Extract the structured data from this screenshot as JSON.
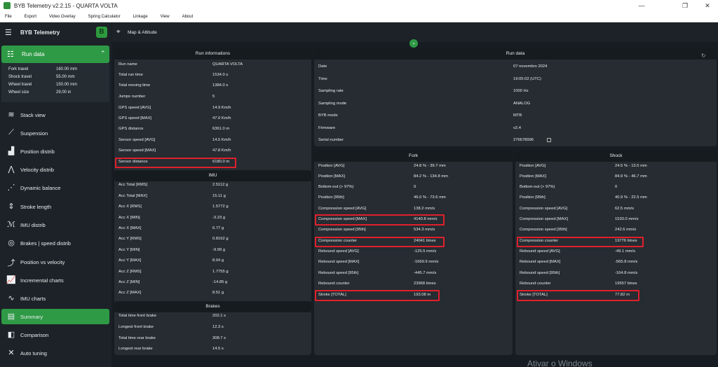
{
  "window": {
    "title": "BYB Telemetry v2.2.15 - QUARTA VOLTA"
  },
  "menu": [
    "File",
    "Export",
    "Video Overlay",
    "Spring Calculator",
    "Linkage",
    "View",
    "About"
  ],
  "sidebar": {
    "app_title": "BYB Telemetry",
    "run_data_label": "Run data",
    "run_summary": [
      {
        "k": "Fork travel",
        "v": "160.00 mm"
      },
      {
        "k": "Shock travel",
        "v": "55.00 mm"
      },
      {
        "k": "Wheel travel",
        "v": "150.00 mm"
      },
      {
        "k": "Wheel size",
        "v": "29.00 in"
      }
    ],
    "items": [
      {
        "label": "Stack view",
        "icon": "layers-icon",
        "glyph": "≋"
      },
      {
        "label": "Suspension",
        "icon": "suspension-icon",
        "glyph": "⟋"
      },
      {
        "label": "Position distrib",
        "icon": "bar-chart-icon",
        "glyph": "▟"
      },
      {
        "label": "Velocity distrib",
        "icon": "bell-curve-icon",
        "glyph": "⋀"
      },
      {
        "label": "Dynamic balance",
        "icon": "scatter-icon",
        "glyph": "⋰"
      },
      {
        "label": "Stroke length",
        "icon": "stroke-icon",
        "glyph": "⇕"
      },
      {
        "label": "IMU distrib",
        "icon": "imu-icon",
        "glyph": "ℳ"
      },
      {
        "label": "Brakes | speed distrib",
        "icon": "brake-disc-icon",
        "glyph": "◎"
      },
      {
        "label": "Position vs velocity",
        "icon": "scatter-trend-icon",
        "glyph": "⤴"
      },
      {
        "label": "Incremental charts",
        "icon": "line-chart-icon",
        "glyph": "📈"
      },
      {
        "label": "IMU charts",
        "icon": "imu-chart-icon",
        "glyph": "∿"
      },
      {
        "label": "Summary",
        "icon": "summary-icon",
        "glyph": "▤"
      },
      {
        "label": "Comparison",
        "icon": "comparison-icon",
        "glyph": "◧"
      },
      {
        "label": "Auto tuning",
        "icon": "tools-icon",
        "glyph": "✕"
      }
    ]
  },
  "topbar": {
    "label": "Map & Altitude"
  },
  "run_info": {
    "title": "Run informations",
    "rows": [
      {
        "k": "Run name",
        "v": "QUARTA VOLTA"
      },
      {
        "k": "Total run time",
        "v": "1534.0 s"
      },
      {
        "k": "Total moving time",
        "v": "1384.0 s"
      },
      {
        "k": "Jumps number",
        "v": "5"
      },
      {
        "k": "GPS speed [AVG]",
        "v": "14.9 Km/h"
      },
      {
        "k": "GPS speed [MAX]",
        "v": "47.0 Km/h"
      },
      {
        "k": "GPS distance",
        "v": "6361.0 m"
      },
      {
        "k": "Sensor speed [AVG]",
        "v": "14.5 Km/h"
      },
      {
        "k": "Sensor speed [MAX]",
        "v": "47.8 Km/h"
      },
      {
        "k": "Sensor distance",
        "v": "6180.0 m"
      }
    ],
    "imu_title": "IMU",
    "imu_rows": [
      {
        "k": "Acc Total [RMS]",
        "v": "2.5112 g"
      },
      {
        "k": "Acc Total [MAX]",
        "v": "15.11 g"
      },
      {
        "k": "Acc X [RMS]",
        "v": "1.5772 g"
      },
      {
        "k": "Acc X [MIN]",
        "v": "-3.23 g"
      },
      {
        "k": "Acc X [MAX]",
        "v": "6.77 g"
      },
      {
        "k": "Acc Y [RMS]",
        "v": "0.8162 g"
      },
      {
        "k": "Acc Y [MIN]",
        "v": "-9.99 g"
      },
      {
        "k": "Acc Y [MAX]",
        "v": "8.04 g"
      },
      {
        "k": "Acc Z [RMS]",
        "v": "1.7755 g"
      },
      {
        "k": "Acc Z [MIN]",
        "v": "-14.85 g"
      },
      {
        "k": "Acc Z [MAX]",
        "v": "8.51 g"
      }
    ],
    "brakes_title": "Brakes",
    "brakes_rows": [
      {
        "k": "Total time front brake",
        "v": "202.1 s"
      },
      {
        "k": "Longest front brake",
        "v": "12.3 s"
      },
      {
        "k": "Total time rear brake",
        "v": "308.7 s"
      },
      {
        "k": "Longest rear brake",
        "v": "14.5 s"
      }
    ]
  },
  "run_data": {
    "title": "Run data",
    "rows": [
      {
        "k": "Date",
        "v": "07 novembro 2024"
      },
      {
        "k": "Time",
        "v": "19:05:02 (UTC)"
      },
      {
        "k": "Sampling rate",
        "v": "1000 Hz"
      },
      {
        "k": "Sampling mode",
        "v": "ANALOG"
      },
      {
        "k": "BYB mode",
        "v": "MTB"
      },
      {
        "k": "Firmware",
        "v": "v2.4"
      },
      {
        "k": "Serial number",
        "v": "276678996"
      }
    ]
  },
  "fork": {
    "title": "Fork",
    "rows": [
      {
        "k": "Position [AVG]",
        "v": "24.8 % - 39.7 mm"
      },
      {
        "k": "Position [MAX]",
        "v": "84.2 % - 134.8 mm"
      },
      {
        "k": "Bottom-out (> 97%)",
        "v": "0"
      },
      {
        "k": "Position [95th]",
        "v": "46.0 % - 73.6 mm"
      },
      {
        "k": "Compression speed [AVG]",
        "v": "138.2 mm/s"
      },
      {
        "k": "Compression speed [MAX]",
        "v": "4140.8 mm/s"
      },
      {
        "k": "Compression speed [95th]",
        "v": "534.3 mm/s"
      },
      {
        "k": "Compression counter",
        "v": "24041 times"
      },
      {
        "k": "Rebound speed [AVG]",
        "v": "-125.5 mm/s"
      },
      {
        "k": "Rebound speed [MAX]",
        "v": "-1669.9 mm/s"
      },
      {
        "k": "Rebound speed [95th]",
        "v": "-445.7 mm/s"
      },
      {
        "k": "Rebound counter",
        "v": "23968 times"
      },
      {
        "k": "Stroke [TOTAL]",
        "v": "193.08 m"
      }
    ]
  },
  "shock": {
    "title": "Shock",
    "rows": [
      {
        "k": "Position [AVG]",
        "v": "24.5 % - 13.5 mm"
      },
      {
        "k": "Position [MAX]",
        "v": "84.9 % - 46.7 mm"
      },
      {
        "k": "Bottom-out (> 97%)",
        "v": "0"
      },
      {
        "k": "Position [95th]",
        "v": "40.9 % - 22.5 mm"
      },
      {
        "k": "Compression speed [AVG]",
        "v": "62.5 mm/s"
      },
      {
        "k": "Compression speed [MAX]",
        "v": "1533.0 mm/s"
      },
      {
        "k": "Compression speed [95th]",
        "v": "242.6 mm/s"
      },
      {
        "k": "Compression counter",
        "v": "19776 times"
      },
      {
        "k": "Rebound speed [AVG]",
        "v": "-49.1 mm/s"
      },
      {
        "k": "Rebound speed [MAX]",
        "v": "-565.8 mm/s"
      },
      {
        "k": "Rebound speed [95th]",
        "v": "-164.8 mm/s"
      },
      {
        "k": "Rebound counter",
        "v": "19557 times"
      },
      {
        "k": "Stroke [TOTAL]",
        "v": "77.82 m"
      }
    ]
  },
  "watermark": "Ativar o Windows",
  "colors": {
    "accent": "#2f9a46",
    "highlight": "#e0202c",
    "panel": "#262c31",
    "background": "#161c21"
  }
}
